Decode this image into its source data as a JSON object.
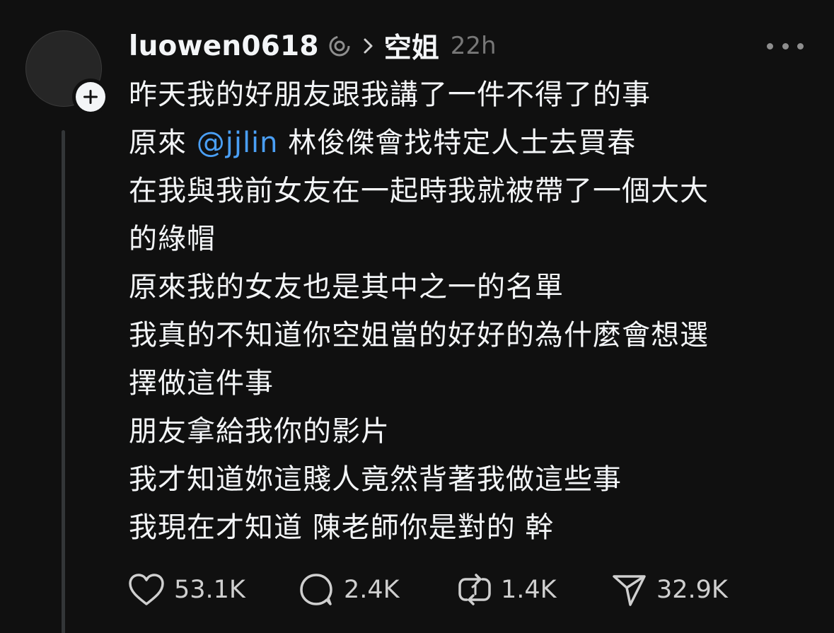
{
  "post": {
    "username": "luowen0618",
    "topic": "空姐",
    "timestamp": "22h",
    "body": {
      "line1": "昨天我的好朋友跟我講了一件不得了的事",
      "line2_prefix": "原來 ",
      "line2_mention": "@jjlin",
      "line2_suffix": " 林俊傑會找特定人士去買春",
      "line3": "在我與我前女友在一起時我就被帶了一個大大",
      "line4": "的綠帽",
      "line5": "原來我的女友也是其中之一的名單",
      "line6": "我真的不知道你空姐當的好好的為什麼會想選",
      "line7": "擇做這件事",
      "line8": "朋友拿給我你的影片",
      "line9": "我才知道妳這賤人竟然背著我做這些事",
      "line10": "我現在才知道 陳老師你是對的  幹"
    },
    "actions": {
      "likes": "53.1K",
      "replies": "2.4K",
      "reposts": "1.4K",
      "shares": "32.9K"
    }
  },
  "icons": {
    "verified": "verified-badge-icon",
    "chevron": "chevron-right-icon",
    "more": "more-options-icon",
    "follow": "plus-icon",
    "like": "heart-icon",
    "reply": "comment-bubble-icon",
    "repost": "repost-icon",
    "share": "send-icon"
  },
  "colors": {
    "background": "#101010",
    "text": "#f3f5f7",
    "muted": "#777777",
    "mention": "#4a9ff5"
  }
}
